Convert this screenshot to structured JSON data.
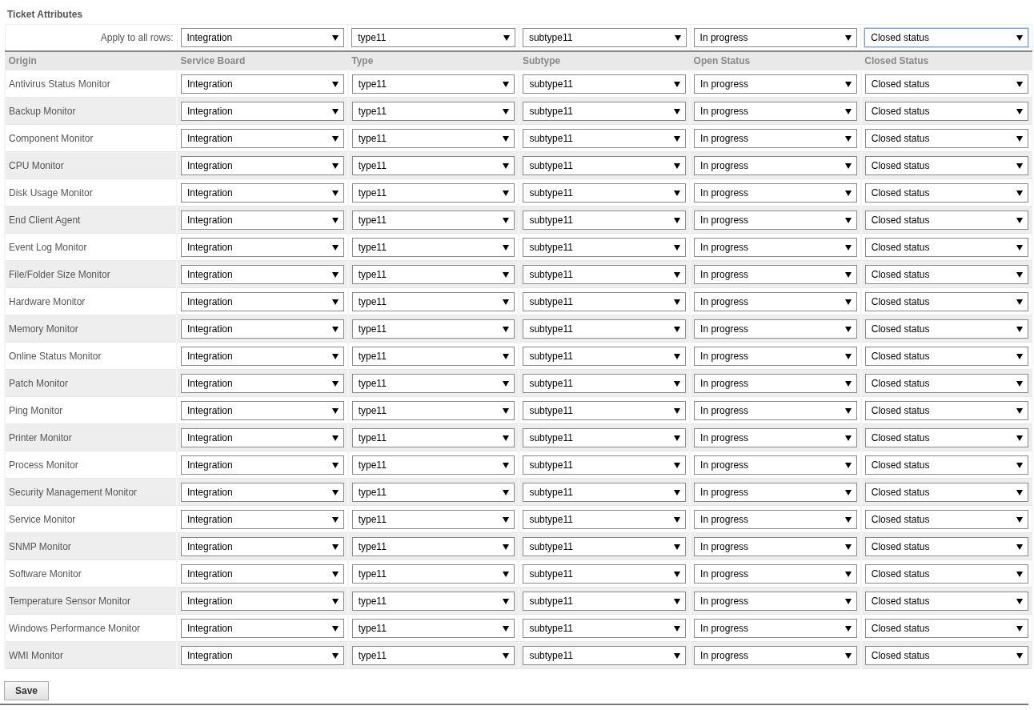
{
  "section_title": "Ticket Attributes",
  "apply_row": {
    "label": "Apply to all rows:",
    "selects": [
      {
        "value": "Integration",
        "focused": false
      },
      {
        "value": "type11",
        "focused": false
      },
      {
        "value": "subtype11",
        "focused": false
      },
      {
        "value": "In progress",
        "focused": false
      },
      {
        "value": "Closed status",
        "focused": true
      }
    ]
  },
  "table": {
    "columns": [
      "Origin",
      "Service Board",
      "Type",
      "Subtype",
      "Open Status",
      "Closed Status"
    ],
    "rows": [
      {
        "origin": "Antivirus Status Monitor",
        "values": [
          "Integration",
          "type11",
          "subtype11",
          "In progress",
          "Closed status"
        ]
      },
      {
        "origin": "Backup Monitor",
        "values": [
          "Integration",
          "type11",
          "subtype11",
          "In progress",
          "Closed status"
        ]
      },
      {
        "origin": "Component Monitor",
        "values": [
          "Integration",
          "type11",
          "subtype11",
          "In progress",
          "Closed status"
        ]
      },
      {
        "origin": "CPU Monitor",
        "values": [
          "Integration",
          "type11",
          "subtype11",
          "In progress",
          "Closed status"
        ]
      },
      {
        "origin": "Disk Usage Monitor",
        "values": [
          "Integration",
          "type11",
          "subtype11",
          "In progress",
          "Closed status"
        ]
      },
      {
        "origin": "End Client Agent",
        "values": [
          "Integration",
          "type11",
          "subtype11",
          "In progress",
          "Closed status"
        ]
      },
      {
        "origin": "Event Log Monitor",
        "values": [
          "Integration",
          "type11",
          "subtype11",
          "In progress",
          "Closed status"
        ]
      },
      {
        "origin": "File/Folder Size Monitor",
        "values": [
          "Integration",
          "type11",
          "subtype11",
          "In progress",
          "Closed status"
        ]
      },
      {
        "origin": "Hardware Monitor",
        "values": [
          "Integration",
          "type11",
          "subtype11",
          "In progress",
          "Closed status"
        ]
      },
      {
        "origin": "Memory Monitor",
        "values": [
          "Integration",
          "type11",
          "subtype11",
          "In progress",
          "Closed status"
        ]
      },
      {
        "origin": "Online Status Monitor",
        "values": [
          "Integration",
          "type11",
          "subtype11",
          "In progress",
          "Closed status"
        ]
      },
      {
        "origin": "Patch Monitor",
        "values": [
          "Integration",
          "type11",
          "subtype11",
          "In progress",
          "Closed status"
        ]
      },
      {
        "origin": "Ping Monitor",
        "values": [
          "Integration",
          "type11",
          "subtype11",
          "In progress",
          "Closed status"
        ]
      },
      {
        "origin": "Printer Monitor",
        "values": [
          "Integration",
          "type11",
          "subtype11",
          "In progress",
          "Closed status"
        ]
      },
      {
        "origin": "Process Monitor",
        "values": [
          "Integration",
          "type11",
          "subtype11",
          "In progress",
          "Closed status"
        ]
      },
      {
        "origin": "Security Management Monitor",
        "values": [
          "Integration",
          "type11",
          "subtype11",
          "In progress",
          "Closed status"
        ]
      },
      {
        "origin": "Service Monitor",
        "values": [
          "Integration",
          "type11",
          "subtype11",
          "In progress",
          "Closed status"
        ]
      },
      {
        "origin": "SNMP Monitor",
        "values": [
          "Integration",
          "type11",
          "subtype11",
          "In progress",
          "Closed status"
        ]
      },
      {
        "origin": "Software Monitor",
        "values": [
          "Integration",
          "type11",
          "subtype11",
          "In progress",
          "Closed status"
        ]
      },
      {
        "origin": "Temperature Sensor Monitor",
        "values": [
          "Integration",
          "type11",
          "subtype11",
          "In progress",
          "Closed status"
        ]
      },
      {
        "origin": "Windows Performance Monitor",
        "values": [
          "Integration",
          "type11",
          "subtype11",
          "In progress",
          "Closed status"
        ]
      },
      {
        "origin": "WMI Monitor",
        "values": [
          "Integration",
          "type11",
          "subtype11",
          "In progress",
          "Closed status"
        ]
      }
    ]
  },
  "save_button": "Save"
}
